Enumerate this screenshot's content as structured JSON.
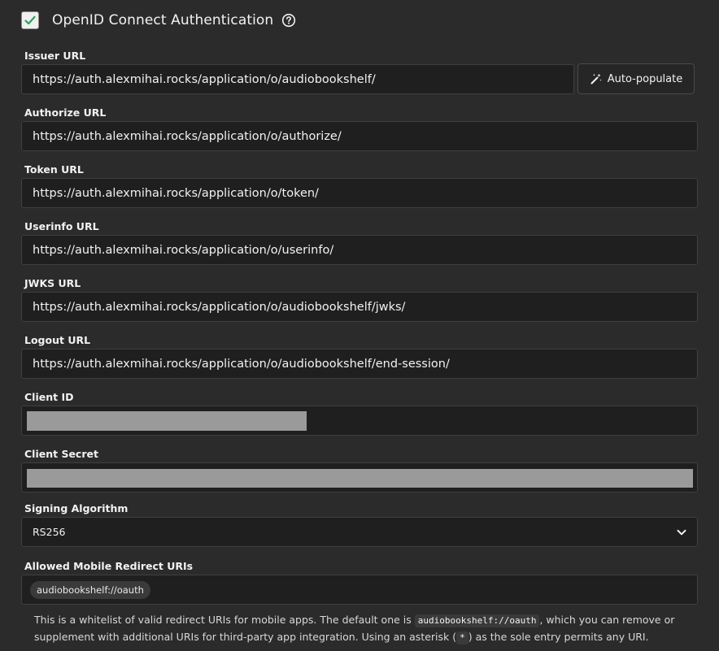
{
  "header": {
    "title": "OpenID Connect Authentication",
    "enabled": true
  },
  "fields": {
    "issuer": {
      "label": "Issuer URL",
      "value": "https://auth.alexmihai.rocks/application/o/audiobookshelf/"
    },
    "authorize": {
      "label": "Authorize URL",
      "value": "https://auth.alexmihai.rocks/application/o/authorize/"
    },
    "token": {
      "label": "Token URL",
      "value": "https://auth.alexmihai.rocks/application/o/token/"
    },
    "userinfo": {
      "label": "Userinfo URL",
      "value": "https://auth.alexmihai.rocks/application/o/userinfo/"
    },
    "jwks": {
      "label": "JWKS URL",
      "value": "https://auth.alexmihai.rocks/application/o/audiobookshelf/jwks/"
    },
    "logout": {
      "label": "Logout URL",
      "value": "https://auth.alexmihai.rocks/application/o/audiobookshelf/end-session/"
    },
    "client_id": {
      "label": "Client ID"
    },
    "client_secret": {
      "label": "Client Secret"
    },
    "signing_algorithm": {
      "label": "Signing Algorithm",
      "value": "RS256"
    },
    "redirect_uris": {
      "label": "Allowed Mobile Redirect URIs",
      "chips": [
        "audiobookshelf://oauth"
      ]
    }
  },
  "buttons": {
    "auto_populate": "Auto-populate"
  },
  "help": {
    "part1": "This is a whitelist of valid redirect URIs for mobile apps. The default one is ",
    "code1": "audiobookshelf://oauth",
    "part2": ", which you can remove or supplement with additional URIs for third-party app integration. Using an asterisk (",
    "code2": "*",
    "part3": ") as the sole entry permits any URI."
  },
  "colors": {
    "background": "#2b2b2b",
    "input_background": "#1f1f1f",
    "check_green": "#2e9e5e",
    "redaction": "#9a9a9a"
  },
  "icons": {
    "checkbox": "check-icon",
    "help": "help-circle-icon",
    "auto_populate": "magic-wand-icon",
    "select": "chevron-down-icon"
  }
}
